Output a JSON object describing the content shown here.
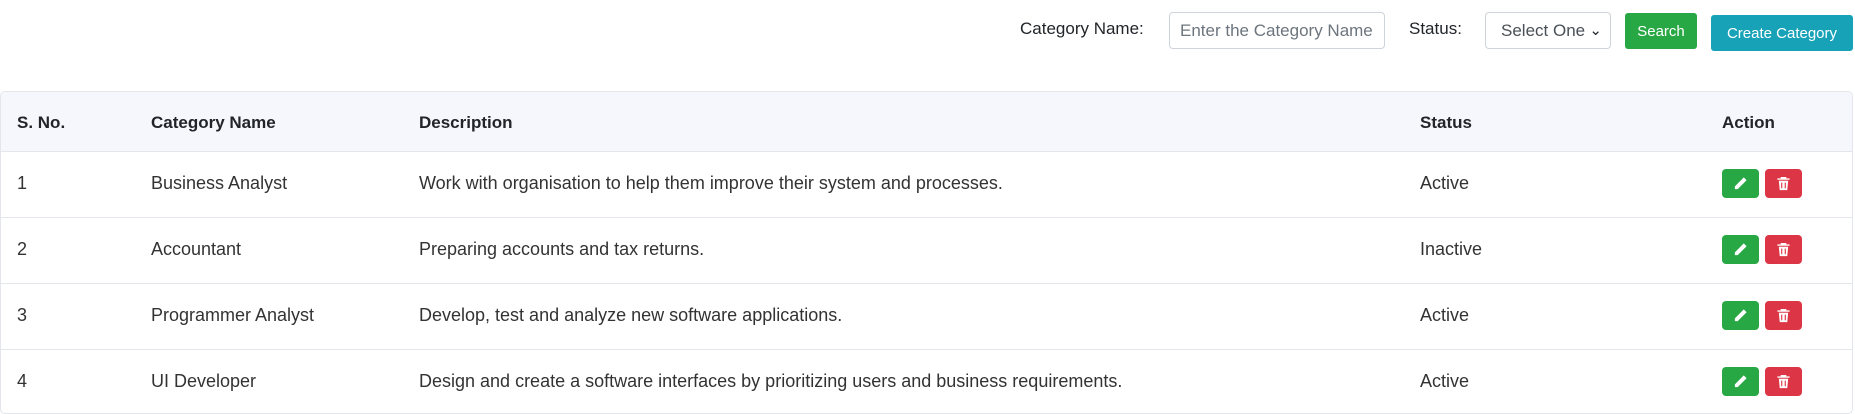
{
  "filters": {
    "category_label": "Category Name:",
    "category_placeholder": "Enter the Category Name",
    "status_label": "Status:",
    "status_selected": "Select One",
    "search_label": "Search",
    "create_label": "Create Category"
  },
  "table": {
    "headers": {
      "sno": "S. No.",
      "name": "Category Name",
      "description": "Description",
      "status": "Status",
      "action": "Action"
    },
    "rows": [
      {
        "sno": "1",
        "name": "Business Analyst",
        "description": "Work with organisation to help them improve their system and processes.",
        "status": "Active"
      },
      {
        "sno": "2",
        "name": "Accountant",
        "description": "Preparing accounts and tax returns.",
        "status": "Inactive"
      },
      {
        "sno": "3",
        "name": "Programmer Analyst",
        "description": "Develop, test and analyze new software applications.",
        "status": "Active"
      },
      {
        "sno": "4",
        "name": "UI Developer",
        "description": "Design and create a software interfaces by prioritizing users and business requirements.",
        "status": "Active"
      }
    ]
  },
  "icons": {
    "edit": "pencil-icon",
    "delete": "trash-icon"
  },
  "colors": {
    "search": "#28a745",
    "create": "#17a2b8",
    "edit": "#28a745",
    "delete": "#dc3545"
  }
}
